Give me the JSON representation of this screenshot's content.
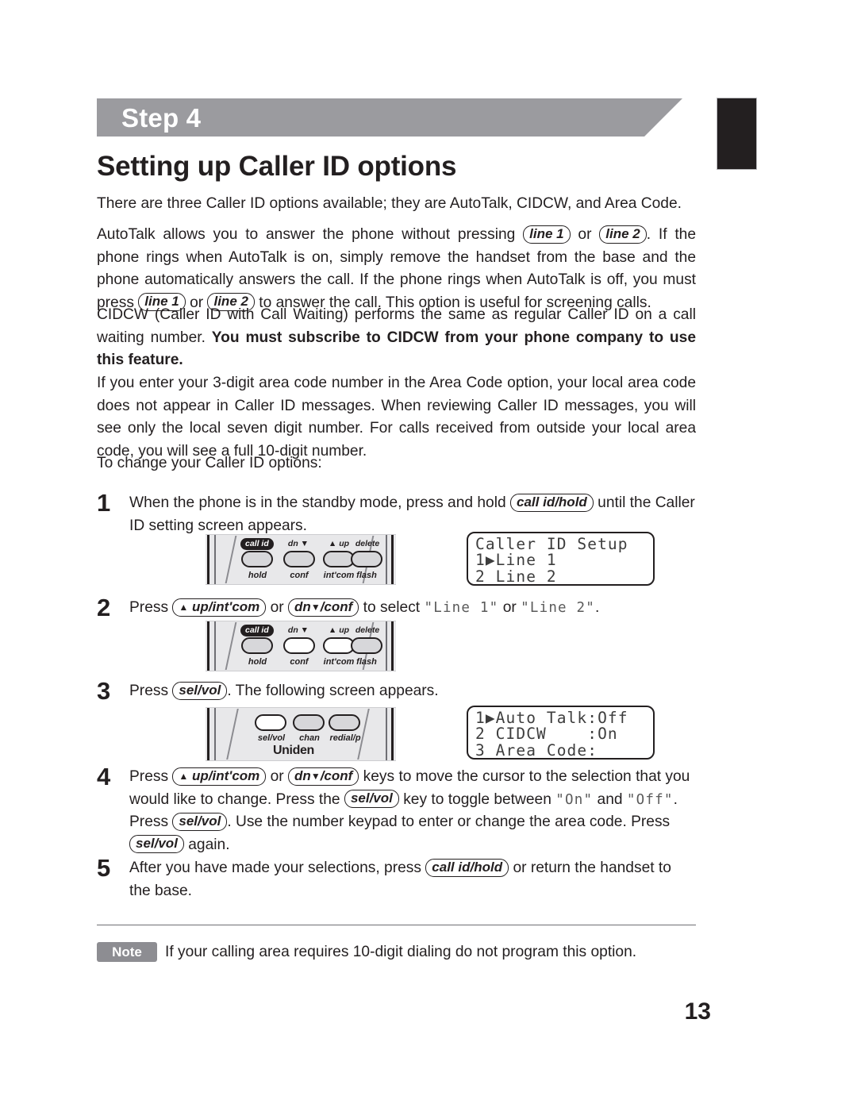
{
  "document": {
    "step_banner_label": "Step 4",
    "title": "Setting up Caller ID options",
    "page_number": "13",
    "colors": {
      "banner_gray": "#9b9b9f",
      "note_gray": "#8d8d92",
      "text_black": "#231f20",
      "keypad_face": "#e8e8ea"
    }
  },
  "intro": {
    "p1": "There are three Caller ID options available; they are AutoTalk, CIDCW, and Area Code.",
    "p2_a": "AutoTalk allows you to answer the phone without pressing",
    "p2_key1": "line 1",
    "p2_or": "or",
    "p2_key2": "line 2",
    "p2_b": ". If the phone rings when AutoTalk is on, simply remove the handset from the base and the phone automatically answers the call. If the phone rings when AutoTalk is off, you must press",
    "p2_key3": "line 1",
    "p2_or2": "or",
    "p2_key4": "line 2",
    "p2_c": "to answer the call. This option is useful for screening calls.",
    "p3_normal": "CIDCW (Caller ID with Call Waiting) performs the same as regular Caller ID on a call waiting number. ",
    "p3_bold": "You must subscribe to CIDCW from your phone company to use this feature.",
    "p4": "If you enter your 3-digit area code number in the Area Code option, your local area code does not appear in Caller ID messages. When reviewing Caller ID messages, you will see only the local seven digit number. For calls received from outside your local area code, you will see a full 10-digit number.",
    "p5": "To change your Caller ID options:"
  },
  "steps": [
    {
      "number": "1",
      "text_a": "When the phone is in the standby mode, press and hold",
      "key1": "call id/hold",
      "text_b": "until the Caller ID setting screen appears."
    },
    {
      "number": "2",
      "text_a": "Press",
      "key1": "up/int'com",
      "text_b": "or",
      "key2": "dn",
      "key2_suffix": "/conf",
      "text_c": "to select",
      "lcd_a": "\"Line 1\"",
      "text_d": "or",
      "lcd_b": "\"Line 2\"",
      "text_e": "."
    },
    {
      "number": "3",
      "text_a": "Press",
      "key1": "sel/vol",
      "text_b": ". The following screen appears."
    },
    {
      "number": "4",
      "text_a": "Press",
      "key1": "up/int'com",
      "text_b": "or",
      "key2": "dn",
      "key2_suffix": "/conf",
      "text_c": "keys to move the cursor to the selection that you would like to change. Press the",
      "key3": "sel/vol",
      "text_d": "key to toggle between",
      "lcd_a": "\"On\"",
      "text_e": "and",
      "lcd_b": "\"Off\"",
      "text_f": ". Press",
      "key4": "sel/vol",
      "text_g": ". Use the number keypad to enter or change the area code. Press",
      "key5": "sel/vol",
      "text_h": "again."
    },
    {
      "number": "5",
      "text_a": "After you have made your selections, press",
      "key1": "call id/hold",
      "text_b": "or return the handset to the base."
    }
  ],
  "keypad_top": {
    "buttons": [
      {
        "top_label": "call id",
        "bottom_label": "hold",
        "top_is_pill": true,
        "highlighted": false
      },
      {
        "top_label": "dn ▼",
        "bottom_label": "conf",
        "top_is_pill": false,
        "highlighted": false
      },
      {
        "top_label": "▲ up",
        "bottom_label": "int'com",
        "top_is_pill": false,
        "highlighted": false
      },
      {
        "top_label": "delete",
        "bottom_label": "flash",
        "top_is_pill": false,
        "highlighted": false
      }
    ]
  },
  "keypad_mid": {
    "buttons": [
      {
        "top_label": "call id",
        "bottom_label": "hold",
        "top_is_pill": true,
        "highlighted": false
      },
      {
        "top_label": "dn ▼",
        "bottom_label": "conf",
        "top_is_pill": false,
        "highlighted": true
      },
      {
        "top_label": "▲ up",
        "bottom_label": "int'com",
        "top_is_pill": false,
        "highlighted": true
      },
      {
        "top_label": "delete",
        "bottom_label": "flash",
        "top_is_pill": false,
        "highlighted": false
      }
    ]
  },
  "keypad_bottom": {
    "brand": "Uniden",
    "buttons": [
      {
        "bottom_label": "sel/vol",
        "highlighted": true
      },
      {
        "bottom_label": "chan",
        "highlighted": false
      },
      {
        "bottom_label": "redial/p",
        "highlighted": false
      }
    ]
  },
  "lcd_screen_1": {
    "line1": "Caller ID Setup",
    "line2": "1▶Line 1",
    "line3": "2 Line 2"
  },
  "lcd_screen_2": {
    "line1": "1▶Auto Talk:Off",
    "line2": "2 CIDCW    :On",
    "line3": "3 Area Code:"
  },
  "note": {
    "badge": "Note",
    "text": "If your calling area requires 10-digit dialing do not program this option."
  }
}
